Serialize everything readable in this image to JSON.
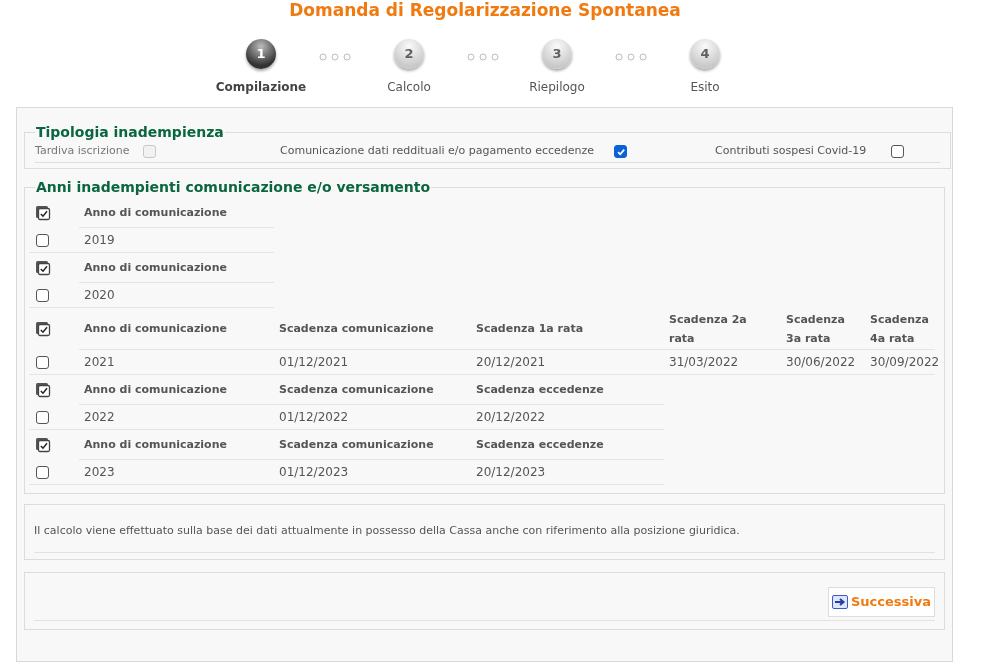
{
  "title": "Domanda di Regolarizzazione Spontanea",
  "steps": [
    {
      "number": "1",
      "label": "Compilazione",
      "selected": true
    },
    {
      "number": "2",
      "label": "Calcolo",
      "selected": false
    },
    {
      "number": "3",
      "label": "Riepilogo",
      "selected": false
    },
    {
      "number": "4",
      "label": "Esito",
      "selected": false
    }
  ],
  "type_section": {
    "legend": "Tipologia inadempienza",
    "options": [
      {
        "label": "Tardiva iscrizione",
        "checked": false,
        "disabled": true
      },
      {
        "label": "Comunicazione dati reddituali e/o pagamento eccedenze",
        "checked": true,
        "disabled": false
      },
      {
        "label": "Contributi sospesi Covid-19",
        "checked": false,
        "disabled": false
      }
    ]
  },
  "years_section": {
    "legend": "Anni inadempienti comunicazione e/o versamento",
    "groups": [
      {
        "columns": [
          "Anno di comunicazione"
        ],
        "rows": [
          {
            "checked": false,
            "cells": [
              "2019"
            ]
          }
        ]
      },
      {
        "columns": [
          "Anno di comunicazione"
        ],
        "rows": [
          {
            "checked": false,
            "cells": [
              "2020"
            ]
          }
        ]
      },
      {
        "columns": [
          "Anno di comunicazione",
          "Scadenza comunicazione",
          "Scadenza 1a rata",
          "Scadenza 2a rata",
          "Scadenza 3a rata",
          "Scadenza 4a rata"
        ],
        "rows": [
          {
            "checked": false,
            "cells": [
              "2021",
              "01/12/2021",
              "20/12/2021",
              "31/03/2022",
              "30/06/2022",
              "30/09/2022"
            ]
          }
        ]
      },
      {
        "columns": [
          "Anno di comunicazione",
          "Scadenza comunicazione",
          "Scadenza eccedenze"
        ],
        "rows": [
          {
            "checked": false,
            "cells": [
              "2022",
              "01/12/2022",
              "20/12/2022"
            ]
          }
        ]
      },
      {
        "columns": [
          "Anno di comunicazione",
          "Scadenza comunicazione",
          "Scadenza eccedenze"
        ],
        "rows": [
          {
            "checked": false,
            "cells": [
              "2023",
              "01/12/2023",
              "20/12/2023"
            ]
          }
        ]
      }
    ]
  },
  "note": "Il calcolo viene effettuato sulla base dei dati attualmente in possesso della Cassa anche con riferimento alla posizione giuridica.",
  "next_button": "Successiva"
}
